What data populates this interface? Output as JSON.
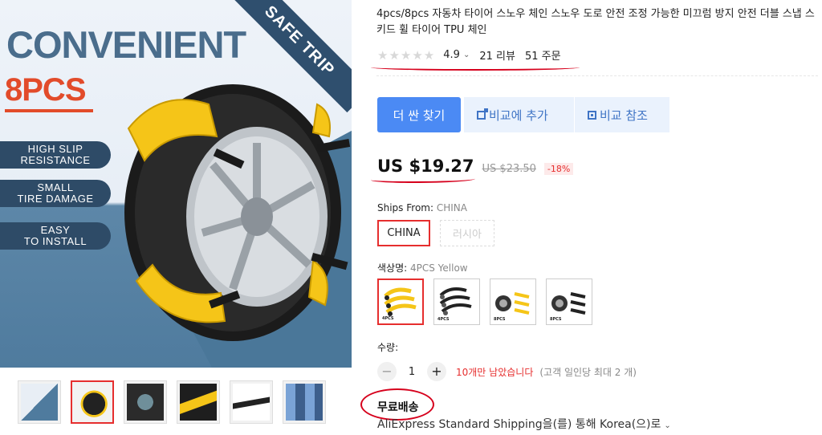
{
  "main_image": {
    "headline": "CONVENIENT",
    "subhead": "8PCS",
    "banner": "SAFE TRIP",
    "features": [
      "HIGH SLIP\nRESISTANCE",
      "SMALL\nTIRE DAMAGE",
      "EASY\nTO INSTALL"
    ]
  },
  "thumbnails": [
    {
      "name": "thumb-1"
    },
    {
      "name": "thumb-2",
      "active": true
    },
    {
      "name": "thumb-3"
    },
    {
      "name": "thumb-4"
    },
    {
      "name": "thumb-5"
    },
    {
      "name": "thumb-6"
    }
  ],
  "product": {
    "title": "4pcs/8pcs 자동차 타이어 스노우 체인 스노우 도로 안전 조정 가능한 미끄럼 방지 안전 더블 스냅 스키드 휠 타이어 TPU 체인",
    "rating": "4.9",
    "reviews": "21 리뷰",
    "orders": "51 주문"
  },
  "actions": {
    "buy_cheaper": "더 싼 찾기",
    "add_compare": "비교에 추가",
    "view_compare": "비교 참조"
  },
  "price": {
    "current": "US $19.27",
    "original": "US $23.50",
    "discount": "-18%"
  },
  "ships_from": {
    "label": "Ships From: ",
    "value": "CHINA",
    "options": [
      "CHINA",
      "러시아"
    ]
  },
  "color": {
    "label": "색상명: ",
    "value": "4PCS Yellow",
    "swatch_tags": [
      "4PCS",
      "4PCS",
      "8PCS",
      "8PCS"
    ]
  },
  "quantity": {
    "label": "수량:",
    "value": "1",
    "minus": "−",
    "plus": "+",
    "stock": "10개만 남았습니다",
    "limit": "(고객 일인당 최대 2 개)"
  },
  "shipping": {
    "free": "무료배송",
    "method": "AliExpress Standard Shipping을(를) 통해 Korea(으)로"
  },
  "colors": {
    "accent_blue": "#4b8af4",
    "price_red": "#e62e2e",
    "annotation_red": "#d6001c",
    "chain_yellow": "#f5c518"
  }
}
